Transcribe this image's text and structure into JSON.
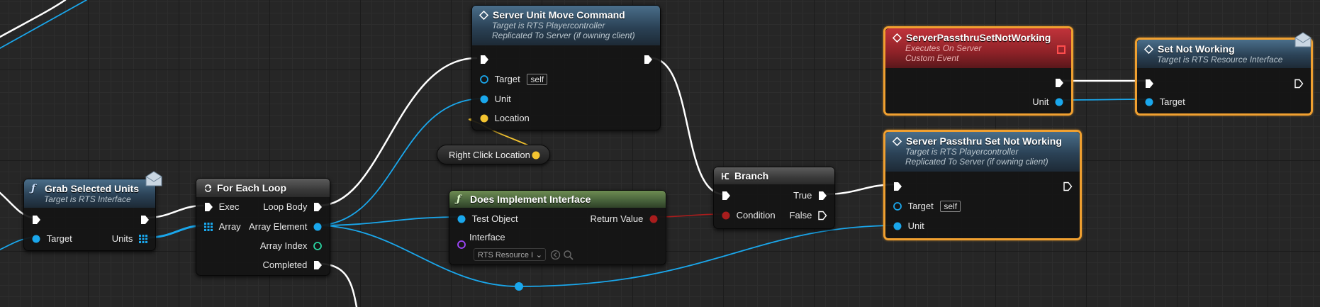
{
  "colors": {
    "exec": "#ffffff",
    "object": "#1aa7ec",
    "struct": "#f4c430",
    "bool": "#a91d1d",
    "int": "#2ad3a0",
    "interface": "#a047ff",
    "selected": "#f0a030"
  },
  "nodes": {
    "grab": {
      "title": "Grab Selected Units",
      "sub": "Target is RTS Interface",
      "pin_target": "Target",
      "pin_units": "Units"
    },
    "foreach": {
      "title": "For Each Loop",
      "pin_exec": "Exec",
      "pin_array": "Array",
      "pin_loop_body": "Loop Body",
      "pin_array_element": "Array Element",
      "pin_array_index": "Array Index",
      "pin_completed": "Completed"
    },
    "move": {
      "title": "Server Unit Move Command",
      "sub1": "Target is RTS Playercontroller",
      "sub2": "Replicated To Server (if owning client)",
      "pin_target": "Target",
      "self": "self",
      "pin_unit": "Unit",
      "pin_location": "Location"
    },
    "rightclick": {
      "label": "Right Click Location"
    },
    "doesimpl": {
      "title": "Does Implement Interface",
      "pin_test_object": "Test Object",
      "pin_return_value": "Return Value",
      "pin_interface": "Interface",
      "interface_value": "RTS Resource I"
    },
    "branch": {
      "title": "Branch",
      "pin_condition": "Condition",
      "pin_true": "True",
      "pin_false": "False"
    },
    "event": {
      "title": "ServerPassthruSetNotWorking",
      "sub1": "Executes On Server",
      "sub2": "Custom Event",
      "pin_unit": "Unit"
    },
    "setnot": {
      "title": "Set Not Working",
      "sub": "Target is RTS Resource Interface",
      "pin_target": "Target"
    },
    "passthru": {
      "title": "Server Passthru Set Not Working",
      "sub1": "Target is RTS Playercontroller",
      "sub2": "Replicated To Server (if owning client)",
      "pin_target": "Target",
      "self": "self",
      "pin_unit": "Unit"
    }
  }
}
